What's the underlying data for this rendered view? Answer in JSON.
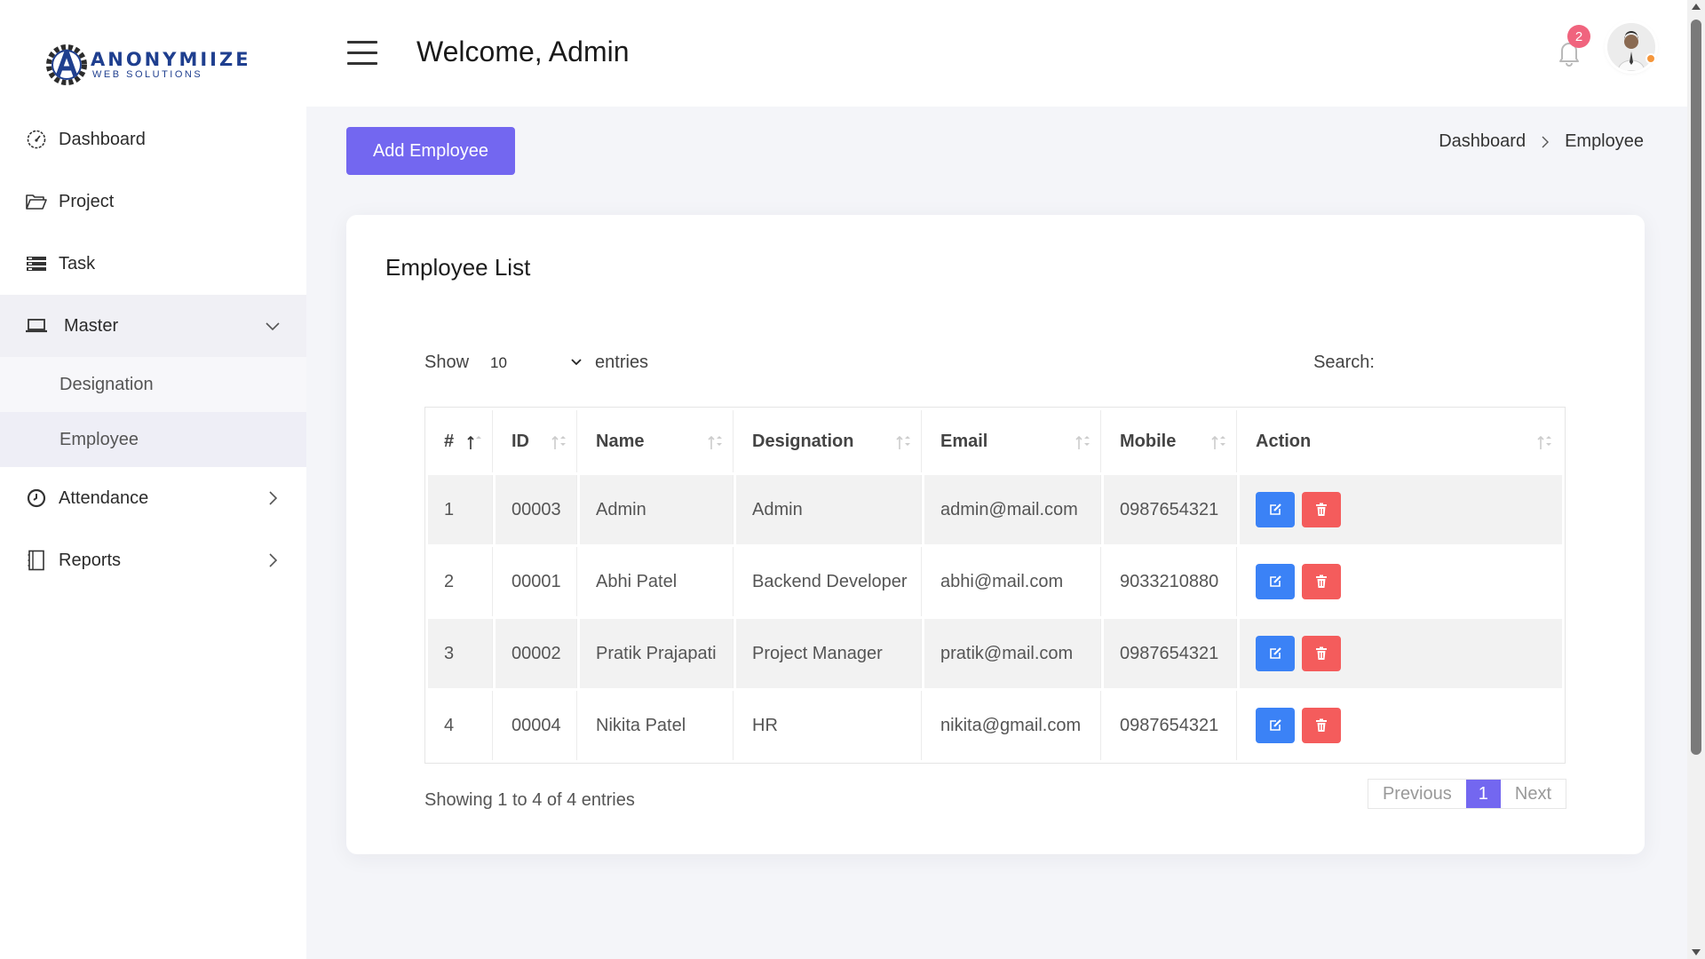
{
  "brand": {
    "name": "ANONYMIIZE",
    "sub": "WEB SOLUTIONS"
  },
  "header": {
    "welcome": "Welcome, Admin",
    "notifications_count": "2"
  },
  "sidebar": {
    "items": [
      {
        "label": "Dashboard",
        "icon": "dashboard-gauge-icon"
      },
      {
        "label": "Project",
        "icon": "folder-icon"
      },
      {
        "label": "Task",
        "icon": "task-list-icon"
      },
      {
        "label": "Master",
        "icon": "laptop-icon",
        "expanded": true
      },
      {
        "label": "Attendance",
        "icon": "clock-icon"
      },
      {
        "label": "Reports",
        "icon": "report-book-icon"
      }
    ],
    "master_sub": [
      "Designation",
      "Employee"
    ]
  },
  "toolbar": {
    "add_label": "Add Employee"
  },
  "breadcrumb": {
    "home": "Dashboard",
    "current": "Employee"
  },
  "card": {
    "title": "Employee List"
  },
  "table_controls": {
    "show_label": "Show",
    "entries_value": "10",
    "entries_label": "entries",
    "search_label": "Search:",
    "search_value": ""
  },
  "table": {
    "columns": [
      "#",
      "ID",
      "Name",
      "Designation",
      "Email",
      "Mobile",
      "Action"
    ],
    "rows": [
      {
        "num": "1",
        "id": "00003",
        "name": "Admin",
        "designation": "Admin",
        "email": "admin@mail.com",
        "mobile": "0987654321"
      },
      {
        "num": "2",
        "id": "00001",
        "name": "Abhi Patel",
        "designation": "Backend Developer",
        "email": "abhi@mail.com",
        "mobile": "9033210880"
      },
      {
        "num": "3",
        "id": "00002",
        "name": "Pratik Prajapati",
        "designation": "Project Manager",
        "email": "pratik@mail.com",
        "mobile": "0987654321"
      },
      {
        "num": "4",
        "id": "00004",
        "name": "Nikita Patel",
        "designation": "HR",
        "email": "nikita@gmail.com",
        "mobile": "0987654321"
      }
    ]
  },
  "footer": {
    "info": "Showing 1 to 4 of 4 entries",
    "prev": "Previous",
    "page": "1",
    "next": "Next"
  },
  "colors": {
    "accent": "#7367f0",
    "edit": "#3b82f6",
    "delete": "#f45c5c",
    "badge": "#f0647e"
  }
}
